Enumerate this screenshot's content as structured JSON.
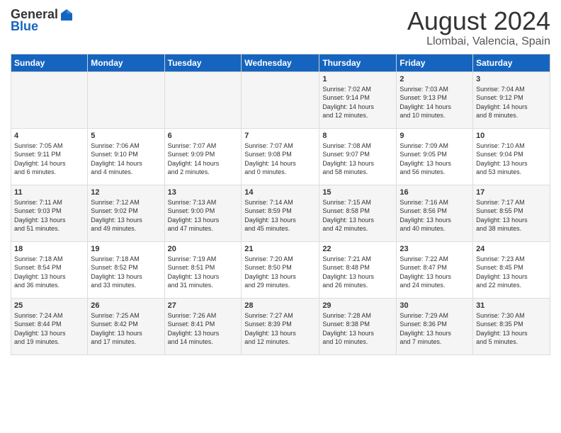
{
  "header": {
    "logo_general": "General",
    "logo_blue": "Blue",
    "main_title": "August 2024",
    "subtitle": "Llombai, Valencia, Spain"
  },
  "days_of_week": [
    "Sunday",
    "Monday",
    "Tuesday",
    "Wednesday",
    "Thursday",
    "Friday",
    "Saturday"
  ],
  "weeks": [
    [
      {
        "day": "",
        "info": ""
      },
      {
        "day": "",
        "info": ""
      },
      {
        "day": "",
        "info": ""
      },
      {
        "day": "",
        "info": ""
      },
      {
        "day": "1",
        "info": "Sunrise: 7:02 AM\nSunset: 9:14 PM\nDaylight: 14 hours\nand 12 minutes."
      },
      {
        "day": "2",
        "info": "Sunrise: 7:03 AM\nSunset: 9:13 PM\nDaylight: 14 hours\nand 10 minutes."
      },
      {
        "day": "3",
        "info": "Sunrise: 7:04 AM\nSunset: 9:12 PM\nDaylight: 14 hours\nand 8 minutes."
      }
    ],
    [
      {
        "day": "4",
        "info": "Sunrise: 7:05 AM\nSunset: 9:11 PM\nDaylight: 14 hours\nand 6 minutes."
      },
      {
        "day": "5",
        "info": "Sunrise: 7:06 AM\nSunset: 9:10 PM\nDaylight: 14 hours\nand 4 minutes."
      },
      {
        "day": "6",
        "info": "Sunrise: 7:07 AM\nSunset: 9:09 PM\nDaylight: 14 hours\nand 2 minutes."
      },
      {
        "day": "7",
        "info": "Sunrise: 7:07 AM\nSunset: 9:08 PM\nDaylight: 14 hours\nand 0 minutes."
      },
      {
        "day": "8",
        "info": "Sunrise: 7:08 AM\nSunset: 9:07 PM\nDaylight: 13 hours\nand 58 minutes."
      },
      {
        "day": "9",
        "info": "Sunrise: 7:09 AM\nSunset: 9:05 PM\nDaylight: 13 hours\nand 56 minutes."
      },
      {
        "day": "10",
        "info": "Sunrise: 7:10 AM\nSunset: 9:04 PM\nDaylight: 13 hours\nand 53 minutes."
      }
    ],
    [
      {
        "day": "11",
        "info": "Sunrise: 7:11 AM\nSunset: 9:03 PM\nDaylight: 13 hours\nand 51 minutes."
      },
      {
        "day": "12",
        "info": "Sunrise: 7:12 AM\nSunset: 9:02 PM\nDaylight: 13 hours\nand 49 minutes."
      },
      {
        "day": "13",
        "info": "Sunrise: 7:13 AM\nSunset: 9:00 PM\nDaylight: 13 hours\nand 47 minutes."
      },
      {
        "day": "14",
        "info": "Sunrise: 7:14 AM\nSunset: 8:59 PM\nDaylight: 13 hours\nand 45 minutes."
      },
      {
        "day": "15",
        "info": "Sunrise: 7:15 AM\nSunset: 8:58 PM\nDaylight: 13 hours\nand 42 minutes."
      },
      {
        "day": "16",
        "info": "Sunrise: 7:16 AM\nSunset: 8:56 PM\nDaylight: 13 hours\nand 40 minutes."
      },
      {
        "day": "17",
        "info": "Sunrise: 7:17 AM\nSunset: 8:55 PM\nDaylight: 13 hours\nand 38 minutes."
      }
    ],
    [
      {
        "day": "18",
        "info": "Sunrise: 7:18 AM\nSunset: 8:54 PM\nDaylight: 13 hours\nand 36 minutes."
      },
      {
        "day": "19",
        "info": "Sunrise: 7:18 AM\nSunset: 8:52 PM\nDaylight: 13 hours\nand 33 minutes."
      },
      {
        "day": "20",
        "info": "Sunrise: 7:19 AM\nSunset: 8:51 PM\nDaylight: 13 hours\nand 31 minutes."
      },
      {
        "day": "21",
        "info": "Sunrise: 7:20 AM\nSunset: 8:50 PM\nDaylight: 13 hours\nand 29 minutes."
      },
      {
        "day": "22",
        "info": "Sunrise: 7:21 AM\nSunset: 8:48 PM\nDaylight: 13 hours\nand 26 minutes."
      },
      {
        "day": "23",
        "info": "Sunrise: 7:22 AM\nSunset: 8:47 PM\nDaylight: 13 hours\nand 24 minutes."
      },
      {
        "day": "24",
        "info": "Sunrise: 7:23 AM\nSunset: 8:45 PM\nDaylight: 13 hours\nand 22 minutes."
      }
    ],
    [
      {
        "day": "25",
        "info": "Sunrise: 7:24 AM\nSunset: 8:44 PM\nDaylight: 13 hours\nand 19 minutes."
      },
      {
        "day": "26",
        "info": "Sunrise: 7:25 AM\nSunset: 8:42 PM\nDaylight: 13 hours\nand 17 minutes."
      },
      {
        "day": "27",
        "info": "Sunrise: 7:26 AM\nSunset: 8:41 PM\nDaylight: 13 hours\nand 14 minutes."
      },
      {
        "day": "28",
        "info": "Sunrise: 7:27 AM\nSunset: 8:39 PM\nDaylight: 13 hours\nand 12 minutes."
      },
      {
        "day": "29",
        "info": "Sunrise: 7:28 AM\nSunset: 8:38 PM\nDaylight: 13 hours\nand 10 minutes."
      },
      {
        "day": "30",
        "info": "Sunrise: 7:29 AM\nSunset: 8:36 PM\nDaylight: 13 hours\nand 7 minutes."
      },
      {
        "day": "31",
        "info": "Sunrise: 7:30 AM\nSunset: 8:35 PM\nDaylight: 13 hours\nand 5 minutes."
      }
    ]
  ]
}
